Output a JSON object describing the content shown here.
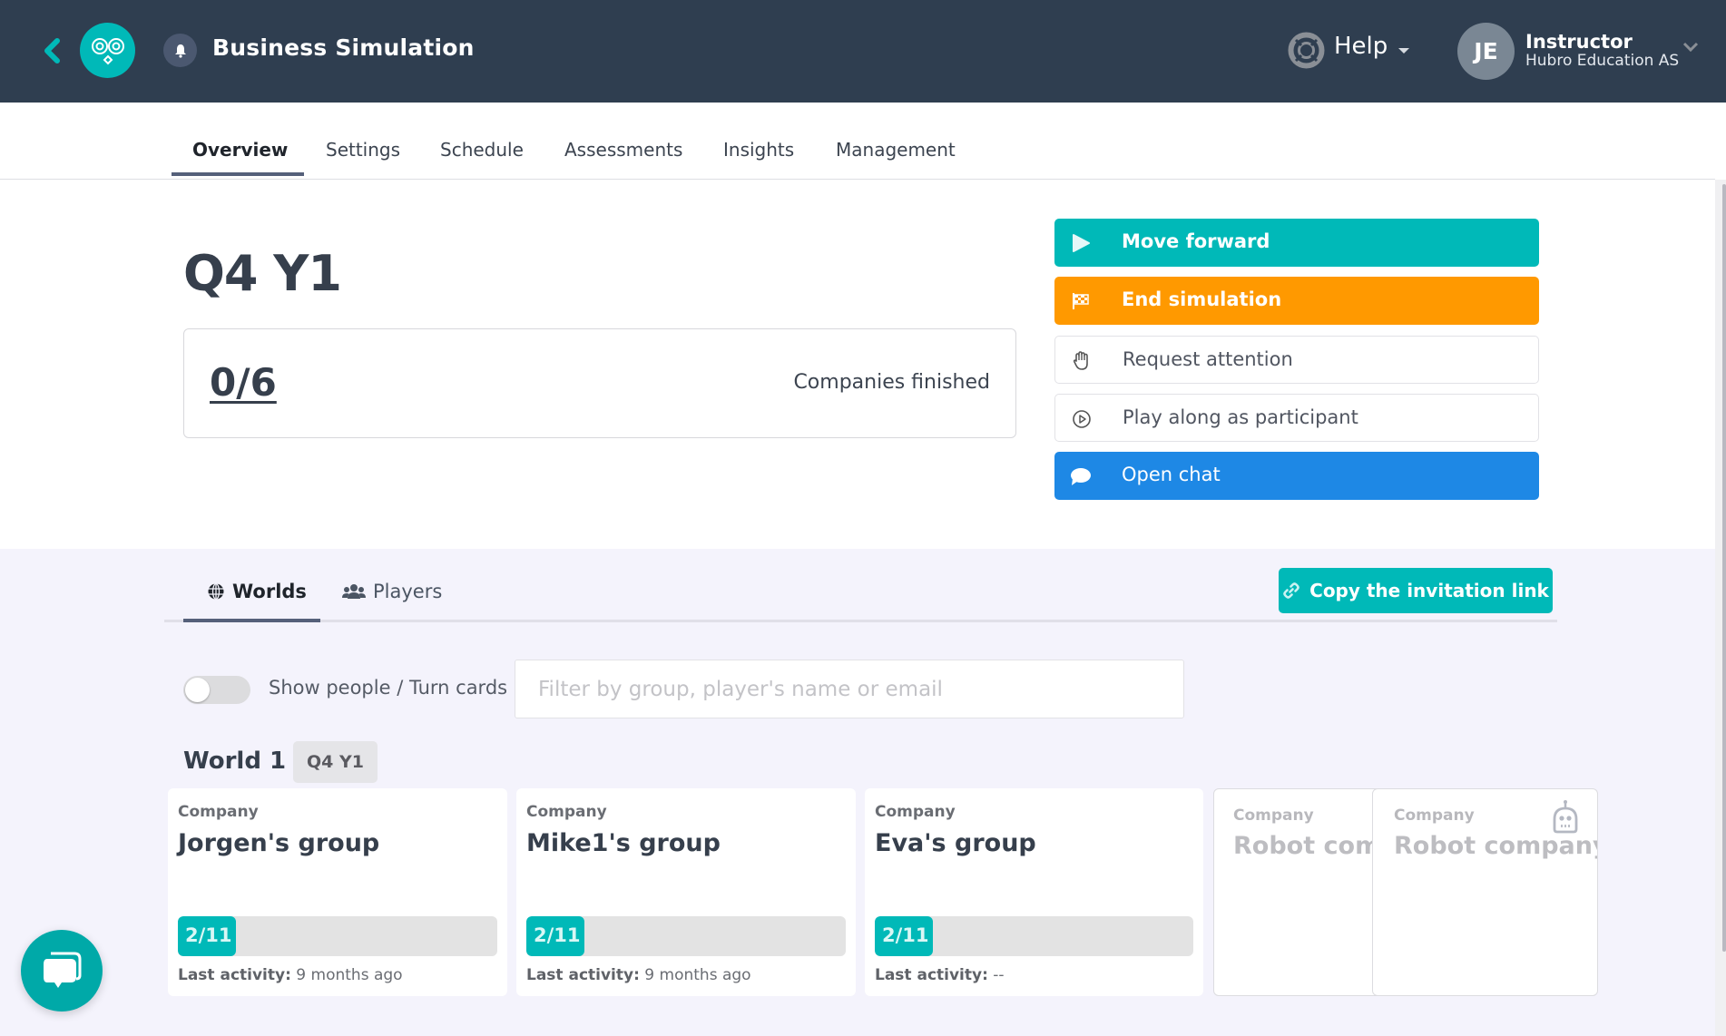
{
  "header": {
    "app_title": "Business Simulation",
    "help_label": "Help",
    "user": {
      "initials": "JE",
      "role": "Instructor",
      "organization": "Hubro Education AS"
    },
    "icons": {
      "back": "chevron-left-icon",
      "logo": "owl-logo-icon",
      "notifications": "bell-icon",
      "help": "lifebuoy-icon",
      "help_caret": "caret-down-icon",
      "user_menu": "chevron-down-icon"
    }
  },
  "nav": {
    "tabs": [
      {
        "label": "Overview",
        "active": true
      },
      {
        "label": "Settings",
        "active": false
      },
      {
        "label": "Schedule",
        "active": false
      },
      {
        "label": "Assessments",
        "active": false
      },
      {
        "label": "Insights",
        "active": false
      },
      {
        "label": "Management",
        "active": false
      }
    ]
  },
  "overview": {
    "period_title": "Q4 Y1",
    "companies_finished": {
      "value": "0/6",
      "label": "Companies finished"
    },
    "actions": [
      {
        "label": "Move forward",
        "icon": "play-icon",
        "style": "teal"
      },
      {
        "label": "End simulation",
        "icon": "checkered-flag-icon",
        "style": "orange"
      },
      {
        "label": "Request attention",
        "icon": "raised-hand-icon",
        "style": "white"
      },
      {
        "label": "Play along as participant",
        "icon": "play-circle-icon",
        "style": "white"
      },
      {
        "label": "Open chat",
        "icon": "chat-bubble-icon",
        "style": "blue"
      }
    ]
  },
  "lower": {
    "tabs": [
      {
        "label": "Worlds",
        "icon": "globe-icon",
        "active": true
      },
      {
        "label": "Players",
        "icon": "users-icon",
        "active": false
      }
    ],
    "copy_invitation_label": "Copy the invitation link",
    "toggle": {
      "label": "Show people / Turn cards",
      "on": false
    },
    "filter": {
      "value": "",
      "placeholder": "Filter by group, player's name or email"
    },
    "world": {
      "title": "World 1",
      "period_badge": "Q4 Y1",
      "companies": [
        {
          "label": "Company",
          "name": "Jorgen's group",
          "progress_text": "2/11",
          "progress": 0.1818,
          "activity_label": "Last activity:",
          "activity_value": "9 months ago"
        },
        {
          "label": "Company",
          "name": "Mike1's group",
          "progress_text": "2/11",
          "progress": 0.1818,
          "activity_label": "Last activity:",
          "activity_value": "9 months ago"
        },
        {
          "label": "Company",
          "name": "Eva's group",
          "progress_text": "2/11",
          "progress": 0.1818,
          "activity_label": "Last activity:",
          "activity_value": "--"
        }
      ],
      "robot_companies": [
        {
          "label": "Company",
          "name": "Robot company"
        },
        {
          "label": "Company",
          "name": "Robot company",
          "icon": "robot-icon"
        }
      ]
    }
  },
  "colors": {
    "header_bg": "#2f3e50",
    "accent_teal": "#00b9b8",
    "accent_orange": "#ff9900",
    "accent_blue": "#1e88e5",
    "section_bg": "#f4f3fc"
  }
}
